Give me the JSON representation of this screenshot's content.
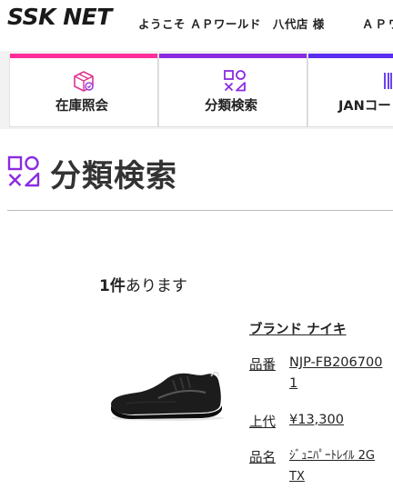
{
  "header": {
    "logo": "SSK NET",
    "welcome": "ようこそ ＡＰワールド　八代店 様",
    "welcome_right": "ＡＰワ"
  },
  "nav": {
    "tabs": [
      {
        "label": "在庫照会",
        "icon": "box-search-icon",
        "color": "#ff2d9a"
      },
      {
        "label": "分類検索",
        "icon": "category-shapes-icon",
        "color": "#8a2be2"
      },
      {
        "label": "JANコード",
        "icon": "barcode-icon",
        "color": "#5a2df0"
      }
    ]
  },
  "page": {
    "title": "分類検索",
    "title_icon": "category-shapes-icon",
    "accent_color": "#8a2be2"
  },
  "results": {
    "count_number": "1件",
    "count_suffix": "あります"
  },
  "product": {
    "image_icon": "running-shoe-image",
    "brand_label": "ブランド",
    "brand_value": "ナイキ",
    "part_number_label": "品番",
    "part_number_value": "NJP-FB2067001",
    "price_label": "上代",
    "price_value": "¥13,300",
    "name_label": "品名",
    "name_value": "ｼﾞｭﾆﾊﾟｰﾄﾚｲﾙ 2GTX"
  }
}
